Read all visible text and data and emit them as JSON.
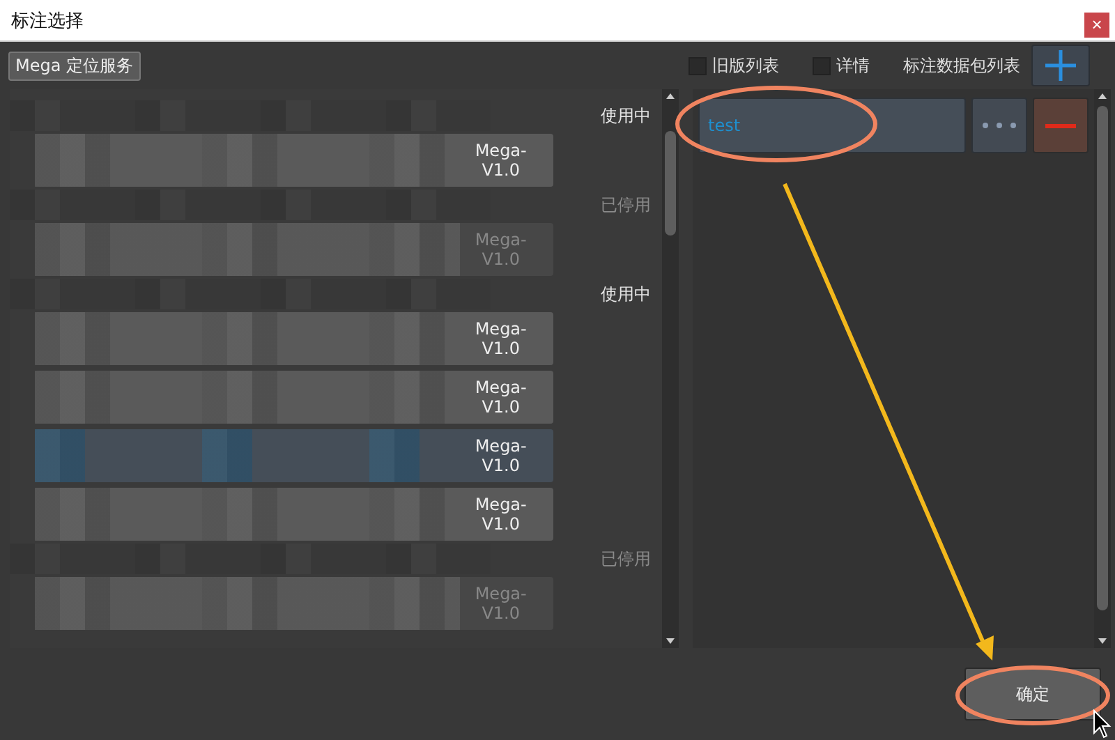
{
  "window": {
    "title": "标注选择",
    "close": "×"
  },
  "toolbar": {
    "service_button": "Mega 定位服务",
    "checkboxes": [
      {
        "label": "旧版列表",
        "checked": false
      },
      {
        "label": "详情",
        "checked": false
      }
    ],
    "list_title": "标注数据包列表"
  },
  "services": [
    {
      "kind": "header",
      "status": "使用中",
      "active": true
    },
    {
      "kind": "row",
      "version": "Mega-V1.0",
      "disabled": false,
      "selected": false
    },
    {
      "kind": "header",
      "status": "已停用",
      "active": false
    },
    {
      "kind": "row",
      "version": "Mega-V1.0",
      "disabled": true,
      "selected": false
    },
    {
      "kind": "header",
      "status": "使用中",
      "active": true
    },
    {
      "kind": "row",
      "version": "Mega-V1.0",
      "disabled": false,
      "selected": false
    },
    {
      "kind": "row",
      "version": "Mega-V1.0",
      "disabled": false,
      "selected": false
    },
    {
      "kind": "row",
      "version": "Mega-V1.0",
      "disabled": false,
      "selected": true
    },
    {
      "kind": "row",
      "version": "Mega-V1.0",
      "disabled": false,
      "selected": false
    },
    {
      "kind": "header",
      "status": "已停用",
      "active": false
    },
    {
      "kind": "row",
      "version": "Mega-V1.0",
      "disabled": true,
      "selected": false
    }
  ],
  "packages": [
    {
      "name": "test"
    }
  ],
  "confirm_button": "确定"
}
